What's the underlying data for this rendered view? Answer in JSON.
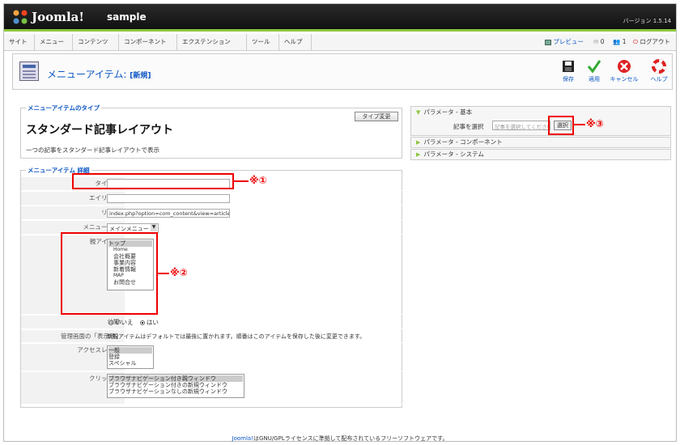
{
  "header": {
    "brand": "Joomla!",
    "site_name": "sample",
    "version": "バージョン 1.5.14"
  },
  "menu": {
    "items": [
      "サイト",
      "メニュー",
      "コンテンツ",
      "コンポーネント",
      "エクステンション",
      "ツール",
      "ヘルプ"
    ]
  },
  "status": {
    "preview": "プレビュー",
    "messages": "0",
    "users": "1",
    "logout": "ログアウト"
  },
  "toolbar": {
    "title": "メニューアイテム:",
    "subtitle": "[新規]",
    "save": "保存",
    "apply": "適用",
    "cancel": "キャンセル",
    "help": "ヘルプ"
  },
  "type_section": {
    "legend": "メニューアイテムのタイプ",
    "change_button": "タイプ変更",
    "title": "スタンダード記事レイアウト",
    "description": "一つの記事をスタンダード記事レイアウトで表示"
  },
  "details": {
    "legend": "メニューアイテム 詳細",
    "title_label": "タイトル:",
    "alias_label": "エイリアス:",
    "link_label": "リンク:",
    "link_value": "index.php?option=com_content&view=article",
    "menu_label": "メニュー表示:",
    "menu_value": "メインメニュー",
    "parent_label": "親アイテム:",
    "parent_options": [
      "トップ",
      "Home",
      "会社概要",
      "事業内容",
      "新着情報",
      "MAP",
      "お問合せ"
    ],
    "published_label": "公開:",
    "published_no": "いいえ",
    "published_yes": "はい",
    "order_label": "管理画面の「表示順」",
    "order_text": "新規アイテムはデフォルトでは最後に置かれます。順番はこのアイテムを保存した後に変更できます。",
    "access_label": "アクセスレベル:",
    "access_options": [
      "一般",
      "登録",
      "スペシャル"
    ],
    "click_label": "クリック時:",
    "click_options": [
      "ブラウザナビゲーション付き親ウィンドウ",
      "ブラウザナビゲーション付きの新規ウィンドウ",
      "ブラウザナビゲーションなしの新規ウィンドウ"
    ]
  },
  "params": {
    "basic": "パラメータ - 基本",
    "article_label": "記事を選択",
    "article_placeholder": "記事を選択してください",
    "select_button": "選択",
    "component": "パラメータ - コンポーネント",
    "system": "パラメータ - システム"
  },
  "annotations": {
    "mark1": "※①",
    "mark2": "※②",
    "mark3": "※③"
  },
  "footer": {
    "link": "Joomla!",
    "text": "はGNU/GPLライセンスに準拠して配布されているフリーソフトウェアです。"
  }
}
